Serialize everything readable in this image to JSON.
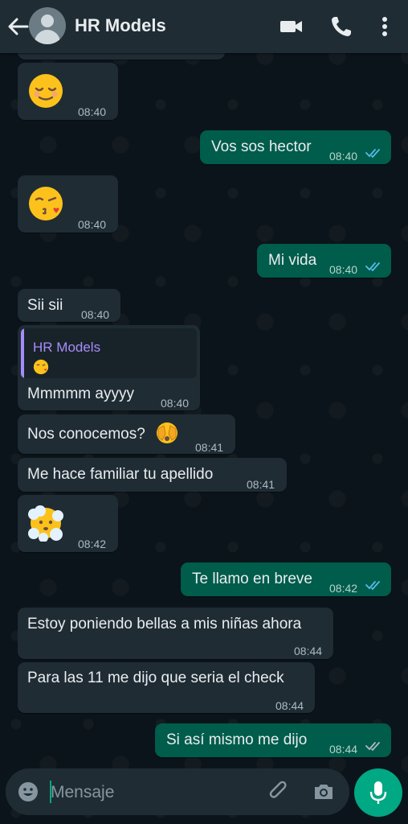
{
  "header": {
    "contact_name": "HR Models",
    "icons": [
      "back-arrow-icon",
      "avatar",
      "video-call-icon",
      "phone-icon",
      "more-vert-icon"
    ]
  },
  "messages": [
    {
      "dir": "in",
      "emoji": "relieved-face",
      "time": "08:40"
    },
    {
      "dir": "out",
      "text": "Vos sos hector",
      "time": "08:40",
      "status": "read"
    },
    {
      "dir": "in",
      "emoji": "face-blowing-kiss",
      "time": "08:40"
    },
    {
      "dir": "out",
      "text": "Mi vida",
      "time": "08:40",
      "status": "read"
    },
    {
      "dir": "in",
      "text": "Sii sii",
      "time": "08:40"
    },
    {
      "dir": "in",
      "quote_author": "HR Models",
      "quote_emoji": "face-blowing-kiss",
      "text": "Mmmmm ayyyy",
      "time": "08:40"
    },
    {
      "dir": "in",
      "text": "Nos conocemos?",
      "emoji": "face-with-peeking-eye",
      "time": "08:41"
    },
    {
      "dir": "in",
      "text": "Me hace familiar tu apellido",
      "time": "08:41"
    },
    {
      "dir": "in",
      "emoji": "face-in-clouds",
      "time": "08:42"
    },
    {
      "dir": "out",
      "text": "Te llamo en breve",
      "time": "08:42",
      "status": "read"
    },
    {
      "dir": "in",
      "text": "Estoy poniendo bellas a mis niñas ahora",
      "time": "08:44"
    },
    {
      "dir": "in",
      "text": "Para las 11 me dijo que seria el check",
      "time": "08:44"
    },
    {
      "dir": "out",
      "text": "Si así mismo me dijo",
      "time": "08:44",
      "status": "delivered"
    }
  ],
  "input": {
    "placeholder": "Mensaje",
    "icons": [
      "emoji-icon",
      "attach-icon",
      "camera-icon",
      "mic-icon"
    ]
  },
  "colors": {
    "background": "#0b141a",
    "header": "#1f2c34",
    "incoming_bubble": "#1f2c34",
    "outgoing_bubble": "#005c4b",
    "accent": "#00a884",
    "read_ticks": "#53bdeb",
    "quote_name": "#a78bfa"
  }
}
